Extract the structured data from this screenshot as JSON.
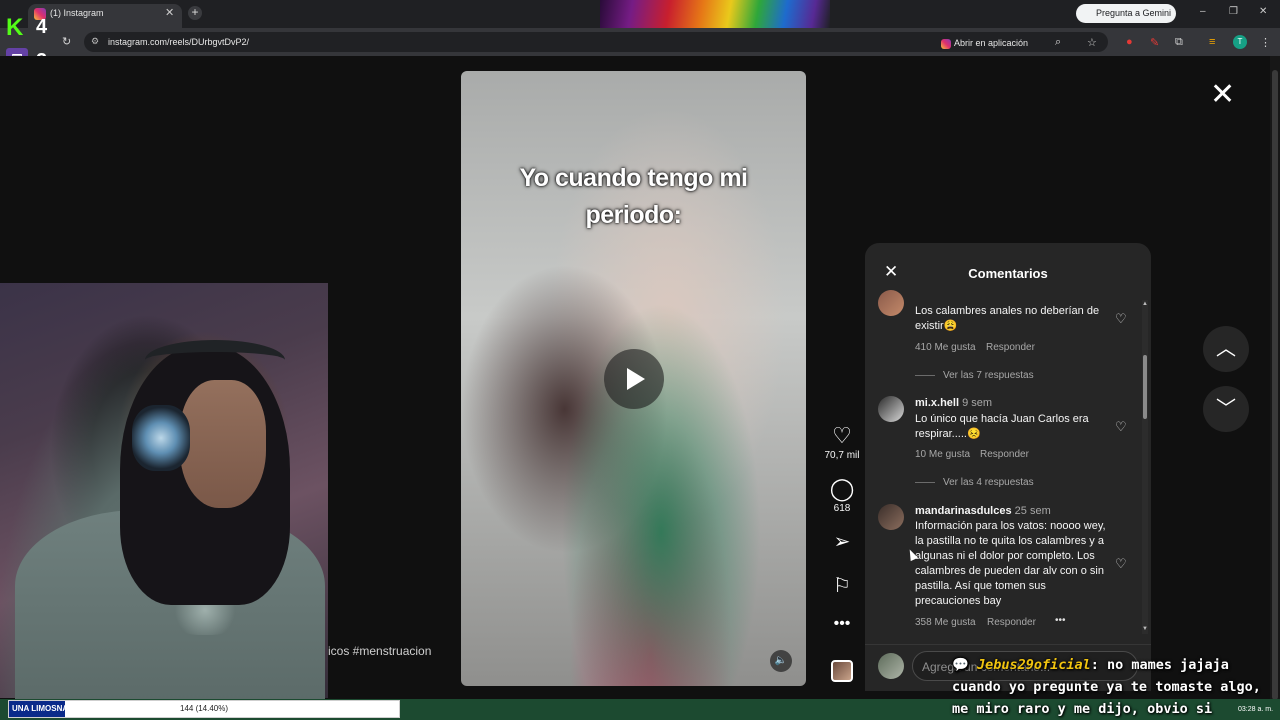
{
  "browser": {
    "tab_title": "(1) Instagram",
    "tab_close": "✕",
    "new_tab": "+",
    "gemini_label": "Pregunta a Gemini",
    "url": "instagram.com/reels/DUrbgvtDvP2/",
    "open_app_label": "Abrir en aplicación",
    "profile_initial": "T",
    "window_buttons": [
      "–",
      "❐",
      "✕"
    ]
  },
  "stream_overlay": {
    "kick_logo": "K",
    "kick_count": "4",
    "twitch_logo": "▣",
    "twitch_count": "2",
    "progress_label": "UNA LIMOSNA BANDA",
    "progress_value": "144 (14.40%)",
    "progress_fraction": 0.144,
    "clock": "03:28 a. m.",
    "chat_icon": "💬",
    "chat_user": "Jebus29oficial",
    "chat_message": ": no mames jajaja cuando yo pregunte ya te tomaste algo, me miro raro y me dijo, obvio si"
  },
  "reel": {
    "caption": "Yo cuando tengo mi periodo:",
    "hashtag_fragment": "icos #menstruacion",
    "likes": "70,7 mil",
    "comments_count": "618",
    "icons": {
      "like": "heart-icon",
      "comment": "comment-icon",
      "share": "send-icon",
      "save": "bookmark-icon",
      "more": "more-icon",
      "mute": "speaker-icon",
      "play": "play-icon"
    }
  },
  "comments_panel": {
    "title": "Comentarios",
    "placeholder": "Agrega un comentario...",
    "items": [
      {
        "user": "",
        "age": "",
        "text": "Los calambres anales no deberían de existir😩",
        "likes": "410 Me gusta",
        "reply_label": "Responder",
        "replies": "Ver las 7 respuestas"
      },
      {
        "user": "mi.x.hell",
        "age": "9 sem",
        "text": "Lo único que hacía Juan Carlos era respirar.....😣",
        "likes": "10 Me gusta",
        "reply_label": "Responder",
        "replies": "Ver las 4 respuestas"
      },
      {
        "user": "mandarinasdulces",
        "age": "25 sem",
        "text": "Información para los vatos: noooo wey, la pastilla no te quita los calambres y a algunas ni el dolor por completo. Los calambres de pueden dar alv con o sin pastilla. Así que tomen sus precauciones bay",
        "likes": "358 Me gusta",
        "reply_label": "Responder",
        "more": "•••"
      }
    ]
  },
  "colors": {
    "page_bg": "#101010",
    "panel_bg": "#262626",
    "kick_green": "#53fc18",
    "twitch_purple": "#6441a5",
    "chat_name": "#f1c40f"
  }
}
